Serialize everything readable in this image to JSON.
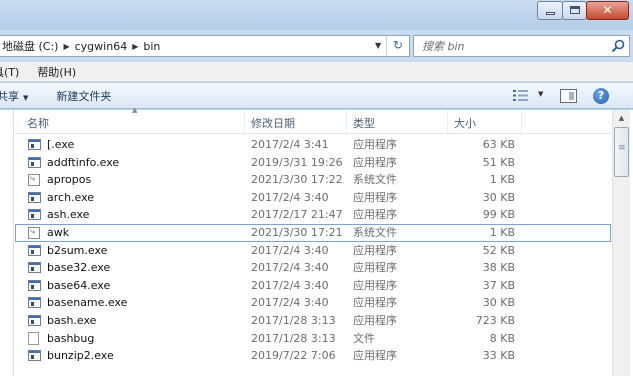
{
  "window_controls": {
    "minimize": "–",
    "maximize": "□",
    "close": "✕"
  },
  "address": {
    "crumbs": [
      "地磁盘 (C:)",
      "cygwin64",
      "bin"
    ],
    "refresh_glyph": "↻"
  },
  "search": {
    "placeholder": "搜索 bin"
  },
  "menu": [
    "具(T)",
    "帮助(H)"
  ],
  "toolbar": {
    "share": "共享",
    "new_folder": "新建文件夹",
    "help": "?"
  },
  "columns": {
    "name": "名称",
    "date": "修改日期",
    "type": "类型",
    "size": "大小"
  },
  "files": [
    {
      "name": "[.exe",
      "date": "2017/2/4 3:41",
      "type": "应用程序",
      "size": "63 KB",
      "icon": "exe"
    },
    {
      "name": "addftinfo.exe",
      "date": "2019/3/31 19:26",
      "type": "应用程序",
      "size": "51 KB",
      "icon": "exe"
    },
    {
      "name": "apropos",
      "date": "2021/3/30 17:22",
      "type": "系统文件",
      "size": "1 KB",
      "icon": "sys"
    },
    {
      "name": "arch.exe",
      "date": "2017/2/4 3:40",
      "type": "应用程序",
      "size": "30 KB",
      "icon": "exe"
    },
    {
      "name": "ash.exe",
      "date": "2017/2/17 21:47",
      "type": "应用程序",
      "size": "99 KB",
      "icon": "exe"
    },
    {
      "name": "awk",
      "date": "2021/3/30 17:21",
      "type": "系统文件",
      "size": "1 KB",
      "icon": "sys",
      "selected": true
    },
    {
      "name": "b2sum.exe",
      "date": "2017/2/4 3:40",
      "type": "应用程序",
      "size": "52 KB",
      "icon": "exe"
    },
    {
      "name": "base32.exe",
      "date": "2017/2/4 3:40",
      "type": "应用程序",
      "size": "38 KB",
      "icon": "exe"
    },
    {
      "name": "base64.exe",
      "date": "2017/2/4 3:40",
      "type": "应用程序",
      "size": "37 KB",
      "icon": "exe"
    },
    {
      "name": "basename.exe",
      "date": "2017/2/4 3:40",
      "type": "应用程序",
      "size": "30 KB",
      "icon": "exe"
    },
    {
      "name": "bash.exe",
      "date": "2017/1/28 3:13",
      "type": "应用程序",
      "size": "723 KB",
      "icon": "exe"
    },
    {
      "name": "bashbug",
      "date": "2017/1/28 3:13",
      "type": "文件",
      "size": "8 KB",
      "icon": "doc"
    },
    {
      "name": "bunzip2.exe",
      "date": "2019/7/22 7:06",
      "type": "应用程序",
      "size": "33 KB",
      "icon": "exe"
    }
  ]
}
